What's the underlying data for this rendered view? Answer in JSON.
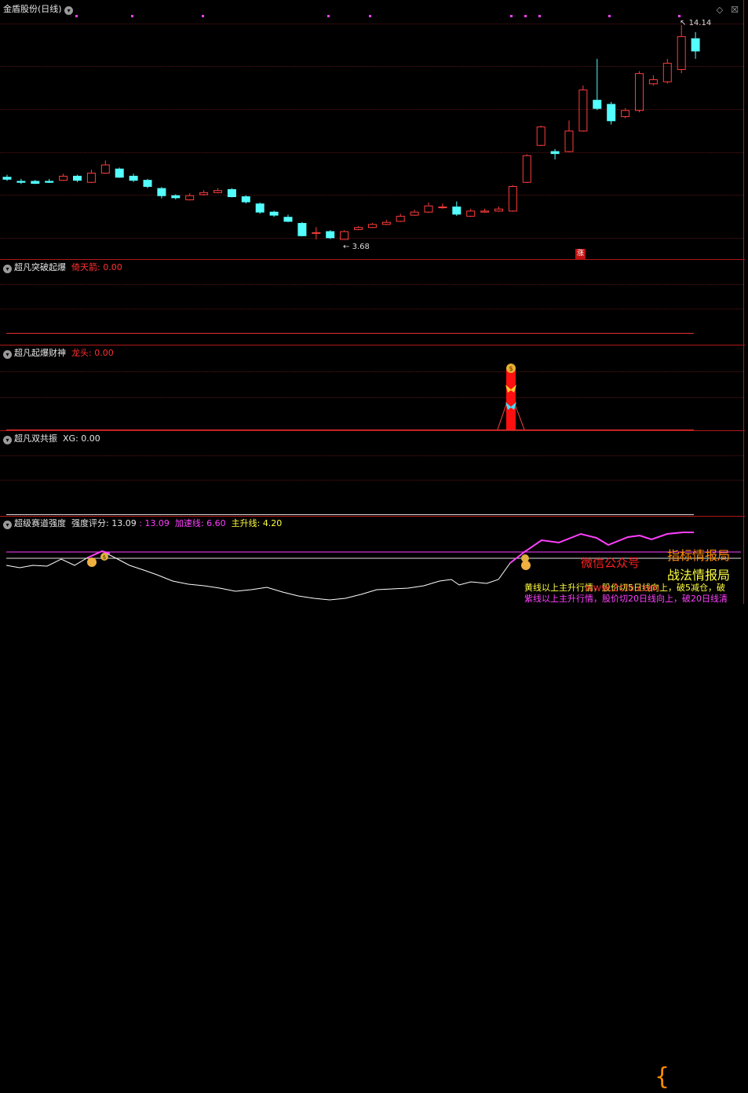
{
  "main": {
    "title": "金盾股份(日线)",
    "high_label": "14.14",
    "low_label": "3.68",
    "zhang_badge": "涨"
  },
  "panels": [
    {
      "name": "超凡突破起爆",
      "key": "倚天箭",
      "key_value": "0.00"
    },
    {
      "name": "超凡起爆财神",
      "key": "龙头",
      "key_value": "0.00"
    },
    {
      "name": "超凡双共振",
      "key": "XG",
      "key_value": "0.00"
    },
    {
      "name": "超级赛道强度",
      "strength_label": "强度评分",
      "strength_value": "13.09",
      "second_value": "13.09",
      "accel_label": "加速线",
      "accel_value": "6.60",
      "main_label": "主升线",
      "main_value": "4.20"
    }
  ],
  "promo": {
    "wechat": "微信公众号",
    "line1": "指标情报局",
    "line2": "战法情报局"
  },
  "bottom_text": {
    "yellow": "黄线以上主升行情，股价切5日线向上，破5减仓，破",
    "magenta": "紫线以上主升行情，股价切20日线向上，破20日线清"
  },
  "watermark": "www.2cto.com",
  "colors": {
    "up": "#ff3c3c",
    "down": "#54ffff",
    "sep": "#b01818",
    "magenta": "#ff40ff",
    "yellow": "#ffff40"
  },
  "chart_data": {
    "type": "candlestick",
    "high_label": 14.14,
    "low_label": 3.68,
    "candles": [
      [
        6.75,
        6.65,
        6.85,
        6.55
      ],
      [
        6.55,
        6.5,
        6.65,
        6.4
      ],
      [
        6.55,
        6.45,
        6.6,
        6.4
      ],
      [
        6.55,
        6.5,
        6.65,
        6.45
      ],
      [
        6.6,
        6.8,
        6.9,
        6.55
      ],
      [
        6.8,
        6.6,
        6.85,
        6.5
      ],
      [
        6.5,
        6.95,
        7.1,
        6.45
      ],
      [
        6.95,
        7.35,
        7.55,
        6.9
      ],
      [
        7.15,
        6.75,
        7.2,
        6.7
      ],
      [
        6.8,
        6.6,
        6.9,
        6.5
      ],
      [
        6.6,
        6.3,
        6.65,
        6.2
      ],
      [
        6.2,
        5.85,
        6.25,
        5.7
      ],
      [
        5.85,
        5.75,
        5.9,
        5.65
      ],
      [
        5.65,
        5.85,
        5.95,
        5.6
      ],
      [
        5.9,
        6.0,
        6.1,
        5.85
      ],
      [
        6.0,
        6.1,
        6.2,
        5.95
      ],
      [
        6.15,
        5.8,
        6.2,
        5.75
      ],
      [
        5.8,
        5.55,
        5.85,
        5.45
      ],
      [
        5.45,
        5.05,
        5.5,
        4.95
      ],
      [
        5.05,
        4.9,
        5.1,
        4.8
      ],
      [
        4.8,
        4.6,
        4.9,
        4.55
      ],
      [
        4.5,
        3.9,
        4.55,
        3.85
      ],
      [
        4.05,
        4.05,
        4.3,
        3.7
      ],
      [
        4.1,
        3.8,
        4.15,
        3.72
      ],
      [
        3.72,
        4.1,
        4.15,
        3.68
      ],
      [
        4.2,
        4.3,
        4.35,
        4.15
      ],
      [
        4.3,
        4.45,
        4.5,
        4.25
      ],
      [
        4.45,
        4.55,
        4.65,
        4.4
      ],
      [
        4.6,
        4.85,
        4.95,
        4.55
      ],
      [
        4.9,
        5.05,
        5.15,
        4.85
      ],
      [
        5.05,
        5.35,
        5.5,
        5.0
      ],
      [
        5.3,
        5.3,
        5.45,
        5.2
      ],
      [
        5.3,
        4.95,
        5.55,
        4.85
      ],
      [
        4.85,
        5.1,
        5.2,
        4.8
      ],
      [
        5.05,
        5.1,
        5.2,
        5.0
      ],
      [
        5.1,
        5.2,
        5.3,
        5.05
      ],
      [
        5.1,
        6.3,
        6.35,
        5.05
      ],
      [
        6.5,
        7.8,
        7.85,
        6.45
      ],
      [
        8.3,
        9.2,
        9.25,
        8.25
      ],
      [
        8.0,
        7.9,
        8.1,
        7.6
      ],
      [
        8.0,
        9.0,
        9.5,
        7.95
      ],
      [
        9.0,
        11.0,
        11.2,
        8.95
      ],
      [
        10.5,
        10.1,
        12.5,
        10.0
      ],
      [
        10.3,
        9.5,
        10.4,
        9.3
      ],
      [
        9.7,
        10.0,
        10.1,
        9.6
      ],
      [
        10.0,
        11.8,
        11.9,
        9.9
      ],
      [
        11.3,
        11.5,
        11.7,
        11.2
      ],
      [
        11.4,
        12.3,
        12.5,
        11.3
      ],
      [
        12.0,
        13.6,
        14.14,
        11.8
      ],
      [
        13.5,
        12.9,
        13.8,
        12.5
      ]
    ]
  }
}
